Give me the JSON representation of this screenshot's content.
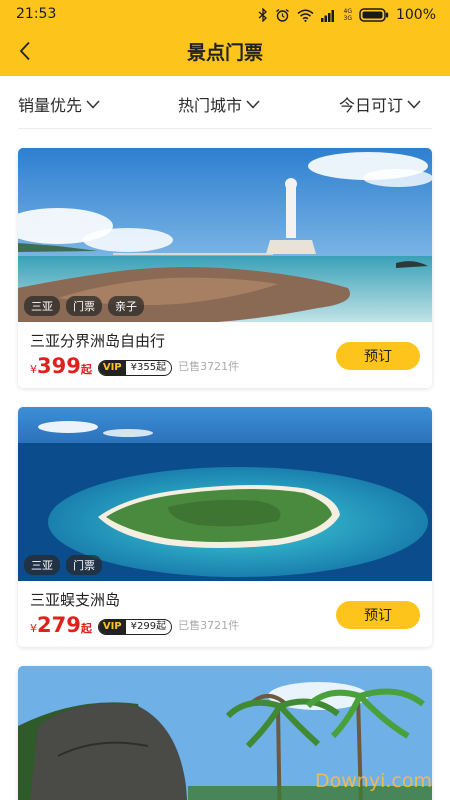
{
  "status_bar": {
    "time": "21:53",
    "network_top": "4G",
    "network_bottom": "3G",
    "battery": "100%"
  },
  "header": {
    "title": "景点门票"
  },
  "filters": [
    {
      "label": "销量优先"
    },
    {
      "label": "热门城市"
    },
    {
      "label": "今日可订"
    }
  ],
  "tickets": [
    {
      "name": "三亚分界洲岛自由行",
      "tags": [
        "三亚",
        "门票",
        "亲子"
      ],
      "currency": "¥",
      "price": "399",
      "price_suffix": "起",
      "vip_label": "VIP",
      "vip_price": "¥355起",
      "sold": "已售3721件",
      "book_label": "预订"
    },
    {
      "name": "三亚蜈支洲岛",
      "tags": [
        "三亚",
        "门票"
      ],
      "currency": "¥",
      "price": "279",
      "price_suffix": "起",
      "vip_label": "VIP",
      "vip_price": "¥299起",
      "sold": "已售3721件",
      "book_label": "预订"
    }
  ],
  "watermark": "Downyi.com",
  "colors": {
    "brand_yellow": "#fdc51b",
    "price_red": "#e0211b",
    "vip_gold": "#fdc51b"
  }
}
